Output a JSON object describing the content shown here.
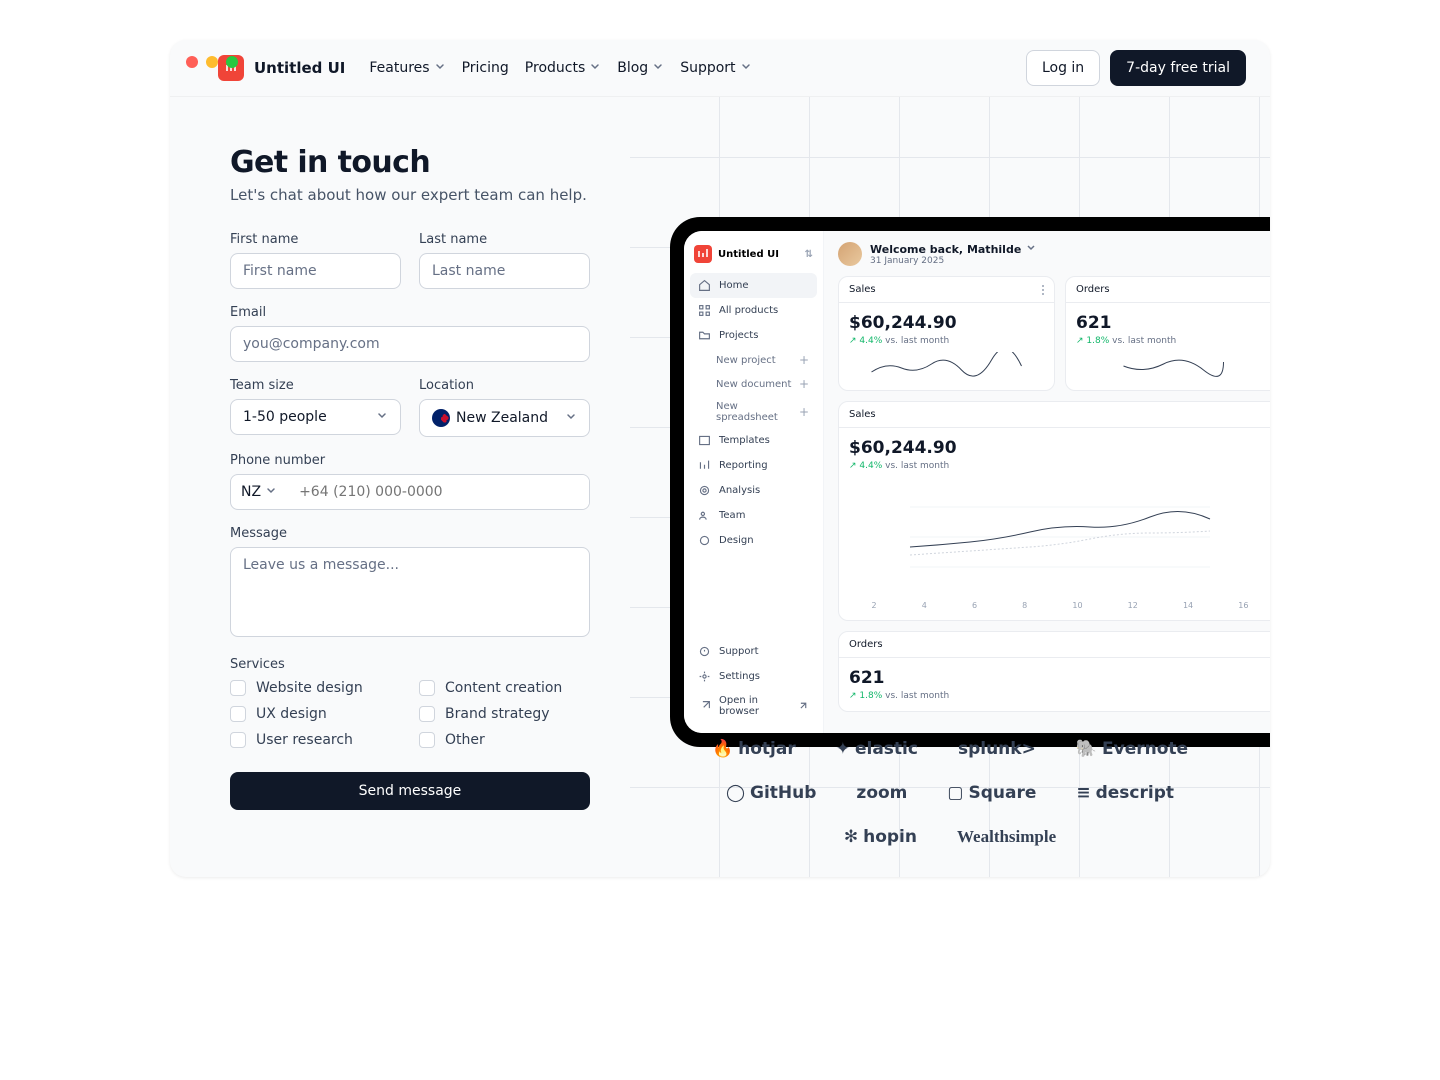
{
  "nav": {
    "brand": "Untitled UI",
    "items": [
      "Features",
      "Pricing",
      "Products",
      "Blog",
      "Support"
    ],
    "login": "Log in",
    "trial": "7-day free trial"
  },
  "hero": {
    "title": "Get in touch",
    "subtitle": "Let's chat about how our expert team can help."
  },
  "form": {
    "first_label": "First name",
    "first_ph": "First name",
    "last_label": "Last name",
    "last_ph": "Last name",
    "email_label": "Email",
    "email_ph": "you@company.com",
    "team_label": "Team size",
    "team_value": "1-50 people",
    "loc_label": "Location",
    "loc_value": "New Zealand",
    "phone_label": "Phone number",
    "phone_cc": "NZ",
    "phone_ph": "+64 (210) 000-0000",
    "msg_label": "Message",
    "msg_ph": "Leave us a message...",
    "services_label": "Services",
    "services": [
      "Website design",
      "Content creation",
      "UX design",
      "Brand strategy",
      "User research",
      "Other"
    ],
    "submit": "Send message"
  },
  "app": {
    "brand": "Untitled UI",
    "side": {
      "home": "Home",
      "all": "All products",
      "proj": "Projects",
      "subs": [
        "New project",
        "New document",
        "New spreadsheet"
      ],
      "tpl": "Templates",
      "rep": "Reporting",
      "ana": "Analysis",
      "team": "Team",
      "design": "Design",
      "support": "Support",
      "settings": "Settings",
      "open": "Open in browser"
    },
    "welcome": "Welcome back, Mathilde",
    "date": "31 January 2025",
    "sales_label": "Sales",
    "orders_label": "Orders",
    "sales": "$60,244.90",
    "orders": "621",
    "sales_delta": "4.4%",
    "orders_delta": "1.8%",
    "delta_suffix": "vs. last month",
    "xticks": [
      "2",
      "4",
      "6",
      "8",
      "10",
      "12",
      "14",
      "16"
    ]
  },
  "logos": [
    "hotjar",
    "elastic",
    "splunk>",
    "Evernote",
    "GitHub",
    "zoom",
    "Square",
    "descript",
    "hopin",
    "Wealthsimple"
  ]
}
